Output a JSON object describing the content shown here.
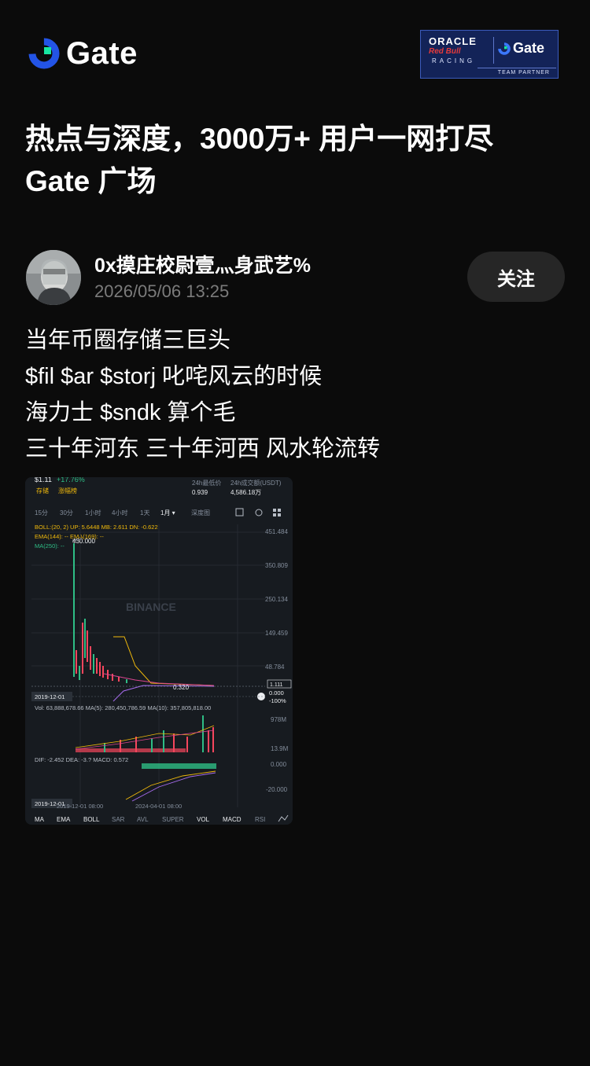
{
  "brand": {
    "name": "Gate"
  },
  "partner_badge": {
    "line1": "ORACLE",
    "line2": "Red Bull",
    "line3": "RACING",
    "brand": "Gate",
    "label": "TEAM PARTNER"
  },
  "headline": {
    "line1": "热点与深度，3000万+ 用户一网打尽",
    "line2": "Gate 广场"
  },
  "author": {
    "name": "0x摸庄校尉壹灬身武艺%",
    "timestamp": "2026/05/06 13:25",
    "follow_label": "关注"
  },
  "post": {
    "lines": [
      "当年币圈存储三巨头",
      "$fil $ar $storj 叱咤风云的时候",
      "海力士 $sndk 算个毛",
      "三十年河东 三十年河西 风水轮流转"
    ]
  },
  "chart_screenshot": {
    "price": "$1.11",
    "change": "+17.76%",
    "tags": [
      "存储",
      "涨幅榜"
    ],
    "low_label": "24h最低价",
    "low_value": "0.939",
    "volume_label": "24h成交额(USDT)",
    "volume_value": "4,586.18万",
    "intervals": [
      "15分",
      "30分",
      "1小时",
      "4小时",
      "1天",
      "1月 ▾",
      "深度图"
    ],
    "boll_line": "BOLL:(20, 2)  UP: 5.6448 MB: 2.611  DN: -0.622",
    "ema_line": "EMA(144): --   EMA(169): --",
    "ma_line": "MA(250): --",
    "watermark": "BINANCE",
    "peak_label": "430.000",
    "low_marker": "0.320",
    "price_tag": "1.111",
    "y_ticks": [
      "451.484",
      "350.809",
      "250.134",
      "149.459",
      "48.784"
    ],
    "right_pct": [
      "0.000",
      "-100%"
    ],
    "start_date": "2019-12-01",
    "vol_line": "Vol: 63,888,678.66  MA(5): 280,450,786.59  MA(10): 357,805,818.00",
    "vol_ticks": [
      "978M",
      "13.9M"
    ],
    "macd_line": "DIF: -2.452  DEA: -3.?  MACD: 0.572",
    "macd_ticks": [
      "0.000",
      "-20.000"
    ],
    "x_labels": [
      "2019-12-01 08:00",
      "2024-04-01 08:00"
    ],
    "indicators": [
      "MA",
      "EMA",
      "BOLL",
      "SAR",
      "AVL",
      "SUPER",
      "VOL",
      "MACD",
      "RSI"
    ],
    "colors": {
      "up": "#2ebd85",
      "down": "#f6465d",
      "accent": "#f0b90b",
      "purple": "#a86cf0"
    }
  }
}
